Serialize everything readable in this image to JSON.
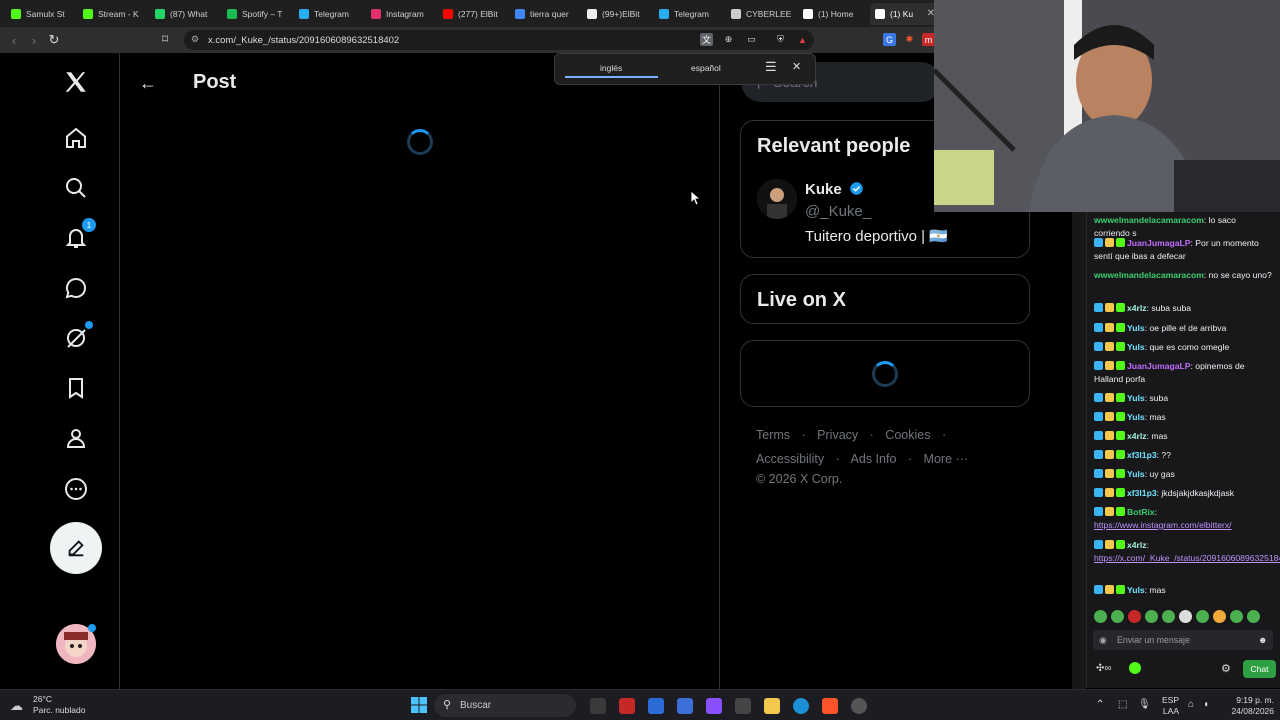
{
  "browser": {
    "tabs": [
      {
        "label": "Samulx St",
        "color": "#53fc18"
      },
      {
        "label": "Stream - K",
        "color": "#53fc18"
      },
      {
        "label": "(87) What",
        "color": "#25d366"
      },
      {
        "label": "Spotify – T",
        "color": "#1db954"
      },
      {
        "label": "Telegram",
        "color": "#2aabee"
      },
      {
        "label": "Instagram",
        "color": "#e1306c"
      },
      {
        "label": "(277) ElBit",
        "color": "#ff0000"
      },
      {
        "label": "tierra quer",
        "color": "#4285f4"
      },
      {
        "label": "(99+)ElBit",
        "color": "#eeeeee"
      },
      {
        "label": "Telegram",
        "color": "#2aabee"
      },
      {
        "label": "CYBERLEE",
        "color": "#cccccc"
      },
      {
        "label": "(1) Home",
        "color": "#ffffff"
      },
      {
        "label": "(1) Ku",
        "color": "#ffffff"
      }
    ],
    "url": "x.com/_Kuke_/status/2091606089632518402"
  },
  "translate_popup": {
    "lang_from": "inglés",
    "lang_to": "español"
  },
  "x": {
    "page_title": "Post",
    "notification_count": "1",
    "search_placeholder": "Search",
    "relevant_people": {
      "title": "Relevant people",
      "name": "Kuke",
      "handle": "@_Kuke_",
      "bio": "Tuitero deportivo | 🇦🇷"
    },
    "live_title": "Live on X",
    "footer": {
      "terms": "Terms",
      "privacy": "Privacy",
      "cookies": "Cookies",
      "accessibility": "Accessibility",
      "ads": "Ads Info",
      "more": "More ···",
      "copyright": "© 2026 X Corp."
    }
  },
  "chat": {
    "messages": [
      {
        "user": "wwwelmandelacamaracom",
        "text": ": lo saco corriendo s"
      },
      {
        "user": "JuanJumagaLP",
        "text": ": Por un momento sentí que ibas a defecar"
      },
      {
        "user": "wwwelmandelacamaracom",
        "text": ": no se cayo uno?"
      },
      {
        "user": "x4rlz",
        "text": ": suba suba"
      },
      {
        "user": "Yuls",
        "text": ": oe pille el de arribva"
      },
      {
        "user": "Yuls",
        "text": ": que es como omegle"
      },
      {
        "user": "JuanJumagaLP",
        "text": ": opinemos de Halland porfa"
      },
      {
        "user": "Yuls",
        "text": ": suba"
      },
      {
        "user": "Yuls",
        "text": ": mas"
      },
      {
        "user": "x4rlz",
        "text": ": mas"
      },
      {
        "user": "xf3l1p3",
        "text": ": ??"
      },
      {
        "user": "Yuls",
        "text": ": uy gas"
      },
      {
        "user": "xf3l1p3",
        "text": ": jkdsjakjdkasjkdjask"
      },
      {
        "user": "BotRix",
        "text": ":",
        "link": "https://www.instagram.com/elbitterx/"
      },
      {
        "user": "x4rlz",
        "text": ":",
        "link": "https://x.com/_Kuke_/status/2091606089632518402"
      },
      {
        "user": "Yuls",
        "text": ": mas"
      }
    ],
    "input_placeholder": "Enviar un mensaje",
    "chat_button": "Chat"
  },
  "taskbar": {
    "weather_temp": "26°C",
    "weather_desc": "Parc. nublado",
    "search_label": "Buscar",
    "lang_top": "ESP",
    "lang_bottom": "LAA",
    "time": "9:19 p. m.",
    "date": "24/08/2026"
  }
}
